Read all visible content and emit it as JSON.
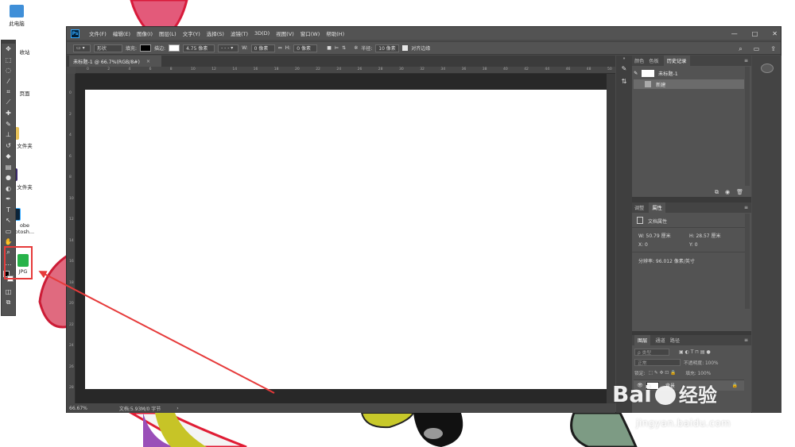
{
  "desktop": {
    "icons": [
      {
        "label": "此电脑"
      },
      {
        "label": "收站"
      },
      {
        "label": "页面"
      },
      {
        "label": "文件夹"
      },
      {
        "label": "文件夹"
      },
      {
        "label": "obe"
      },
      {
        "label": "otosh..."
      },
      {
        "label": "JPG"
      }
    ]
  },
  "app": {
    "logo": "Ps",
    "menu": [
      "文件(F)",
      "编辑(E)",
      "图像(I)",
      "图层(L)",
      "文字(Y)",
      "选择(S)",
      "滤镜(T)",
      "3D(D)",
      "视图(V)",
      "窗口(W)",
      "帮助(H)"
    ],
    "window_controls": [
      "—",
      "□",
      "✕"
    ]
  },
  "options": {
    "mode": "形状",
    "fill_label": "填充:",
    "stroke_label": "描边:",
    "stroke_width": "4.75 像素",
    "w_label": "W:",
    "w_value": "0 像素",
    "link": "⇔",
    "h_label": "H:",
    "h_value": "0 像素",
    "radius_label": "半径:",
    "radius_value": "10 像素",
    "align_edges": "对齐边缘",
    "right_icons": [
      "⌕",
      "▭",
      "⇪"
    ]
  },
  "document": {
    "tab_title": "未标题-1 @ 66.7%(RGB/8#)",
    "tab_close": "×",
    "zoom": "66.67%",
    "doc_info": "文档:5.93M/0 字节",
    "nav": "›"
  },
  "ruler": {
    "h": [
      "0",
      "2",
      "4",
      "6",
      "8",
      "10",
      "12",
      "14",
      "16",
      "18",
      "20",
      "22",
      "24",
      "26",
      "28",
      "30",
      "32",
      "34",
      "36",
      "38",
      "40",
      "42",
      "44",
      "46",
      "48",
      "50"
    ],
    "v": [
      "0",
      "2",
      "4",
      "6",
      "8",
      "10",
      "12",
      "14",
      "16",
      "18",
      "20",
      "22",
      "24",
      "26",
      "28"
    ]
  },
  "history_panel": {
    "tabs": [
      "颜色",
      "色板",
      "历史记录"
    ],
    "snapshot": "未标题-1",
    "step": "新建",
    "footer_icons": [
      "⧉",
      "◉",
      "🗑"
    ]
  },
  "props_panel": {
    "tabs": [
      "调整",
      "属性"
    ],
    "title": "文档属性",
    "w": "W: 50.79 厘米",
    "h": "H: 28.57 厘米",
    "x": "X: 0",
    "y": "Y: 0",
    "resolution": "分辨率: 96.012 像素/英寸"
  },
  "layers_panel": {
    "tabs": [
      "图层",
      "通道",
      "路径"
    ],
    "search": "ρ 类型",
    "blend": "正常",
    "opacity": "不透明度: 100%",
    "lock_label": "锁定:",
    "fill": "填充: 100%",
    "layer_name": "背景",
    "lock_icon": "🔒"
  },
  "watermark": {
    "brand": "Bai",
    "brand_cn": "经验",
    "url": "jingyan.baidu.com"
  },
  "colors": {
    "annotation": "#e63a3a",
    "panel_bg": "#535353",
    "workspace": "#282828"
  }
}
